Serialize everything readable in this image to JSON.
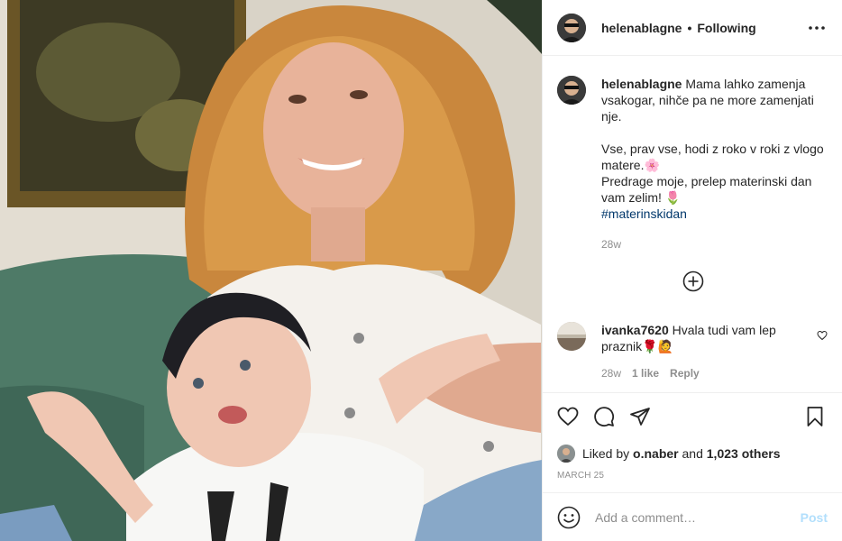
{
  "header": {
    "username": "helenablagne",
    "separator": "•",
    "follow_status": "Following"
  },
  "caption": {
    "username": "helenablagne",
    "line1": "Mama lahko zamenja vsakogar, nihče pa ne more zamenjati nje.",
    "line2": "Vse, prav vse, hodi z roko v roki z vlogo matere.🌸",
    "line3": "Predrage moje, prelep materinski dan vam zelim! 🌷",
    "hashtag": "#materinskidan",
    "time": "28w"
  },
  "comment": {
    "username": "ivanka7620",
    "text": "Hvala tudi vam lep praznik🌹🙋",
    "time": "28w",
    "likes": "1 like",
    "reply": "Reply"
  },
  "likes": {
    "prefix": "Liked by",
    "user": "o.naber",
    "and": "and",
    "count": "1,023 others"
  },
  "date": "MARCH 25",
  "add_comment": {
    "placeholder": "Add a comment…",
    "post_label": "Post"
  },
  "icons": {
    "more": "more-horizontal-icon",
    "like": "heart-outline-icon",
    "comment": "speech-bubble-icon",
    "share": "paper-plane-icon",
    "save": "bookmark-icon",
    "load_more": "plus-circle-icon",
    "emoji": "smiley-icon"
  },
  "colors": {
    "hashtag": "#00376b",
    "muted": "#8e8e8e",
    "post_button": "#b2dffc",
    "border": "#efefef"
  }
}
